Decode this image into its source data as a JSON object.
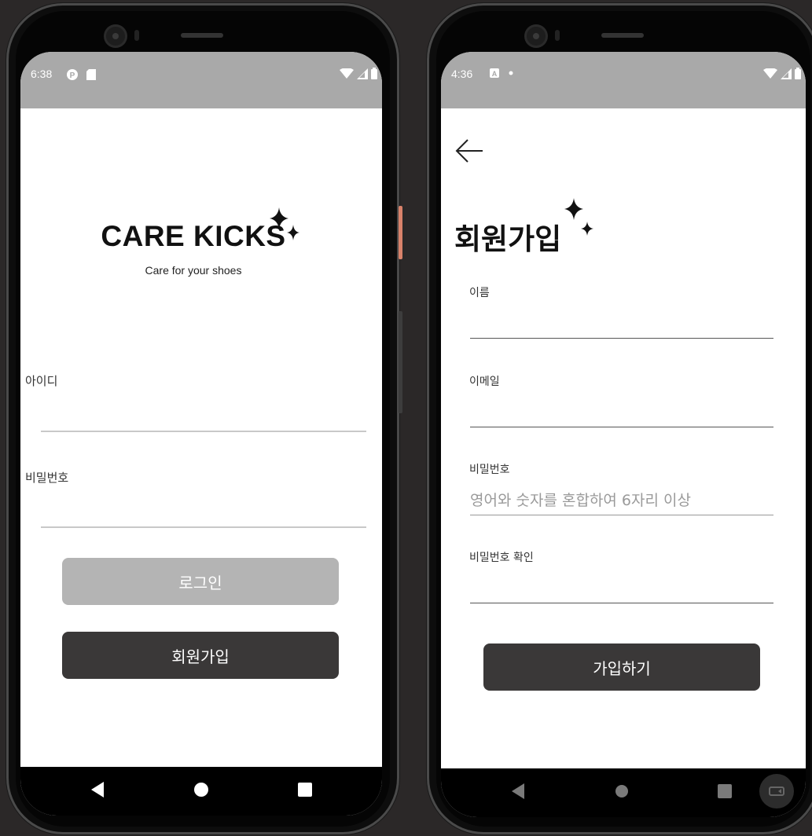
{
  "login_screen": {
    "status_time": "6:38",
    "brand": {
      "name": "CARE KICKS",
      "tagline": "Care for your shoes"
    },
    "id_label": "아이디",
    "password_label": "비밀번호",
    "login_button": "로그인",
    "signup_button": "회원가입"
  },
  "signup_screen": {
    "status_time": "4:36",
    "title": "회원가입",
    "fields": {
      "name_label": "이름",
      "email_label": "이메일",
      "password_label": "비밀번호",
      "password_placeholder": "영어와 숫자를 혼합하여 6자리 이상",
      "password_confirm_label": "비밀번호 확인"
    },
    "submit_button": "가입하기"
  },
  "colors": {
    "statusbar": "#a9a9a9",
    "login_button_disabled": "#b4b4b4",
    "dark_button": "#3a3838",
    "accent_side_button": "#d9826a"
  },
  "icons": [
    "back-arrow-icon",
    "sparkle-icon",
    "wifi-icon",
    "signal-icon",
    "battery-icon",
    "nav-back-icon",
    "nav-home-icon",
    "nav-recents-icon",
    "rotate-icon"
  ]
}
